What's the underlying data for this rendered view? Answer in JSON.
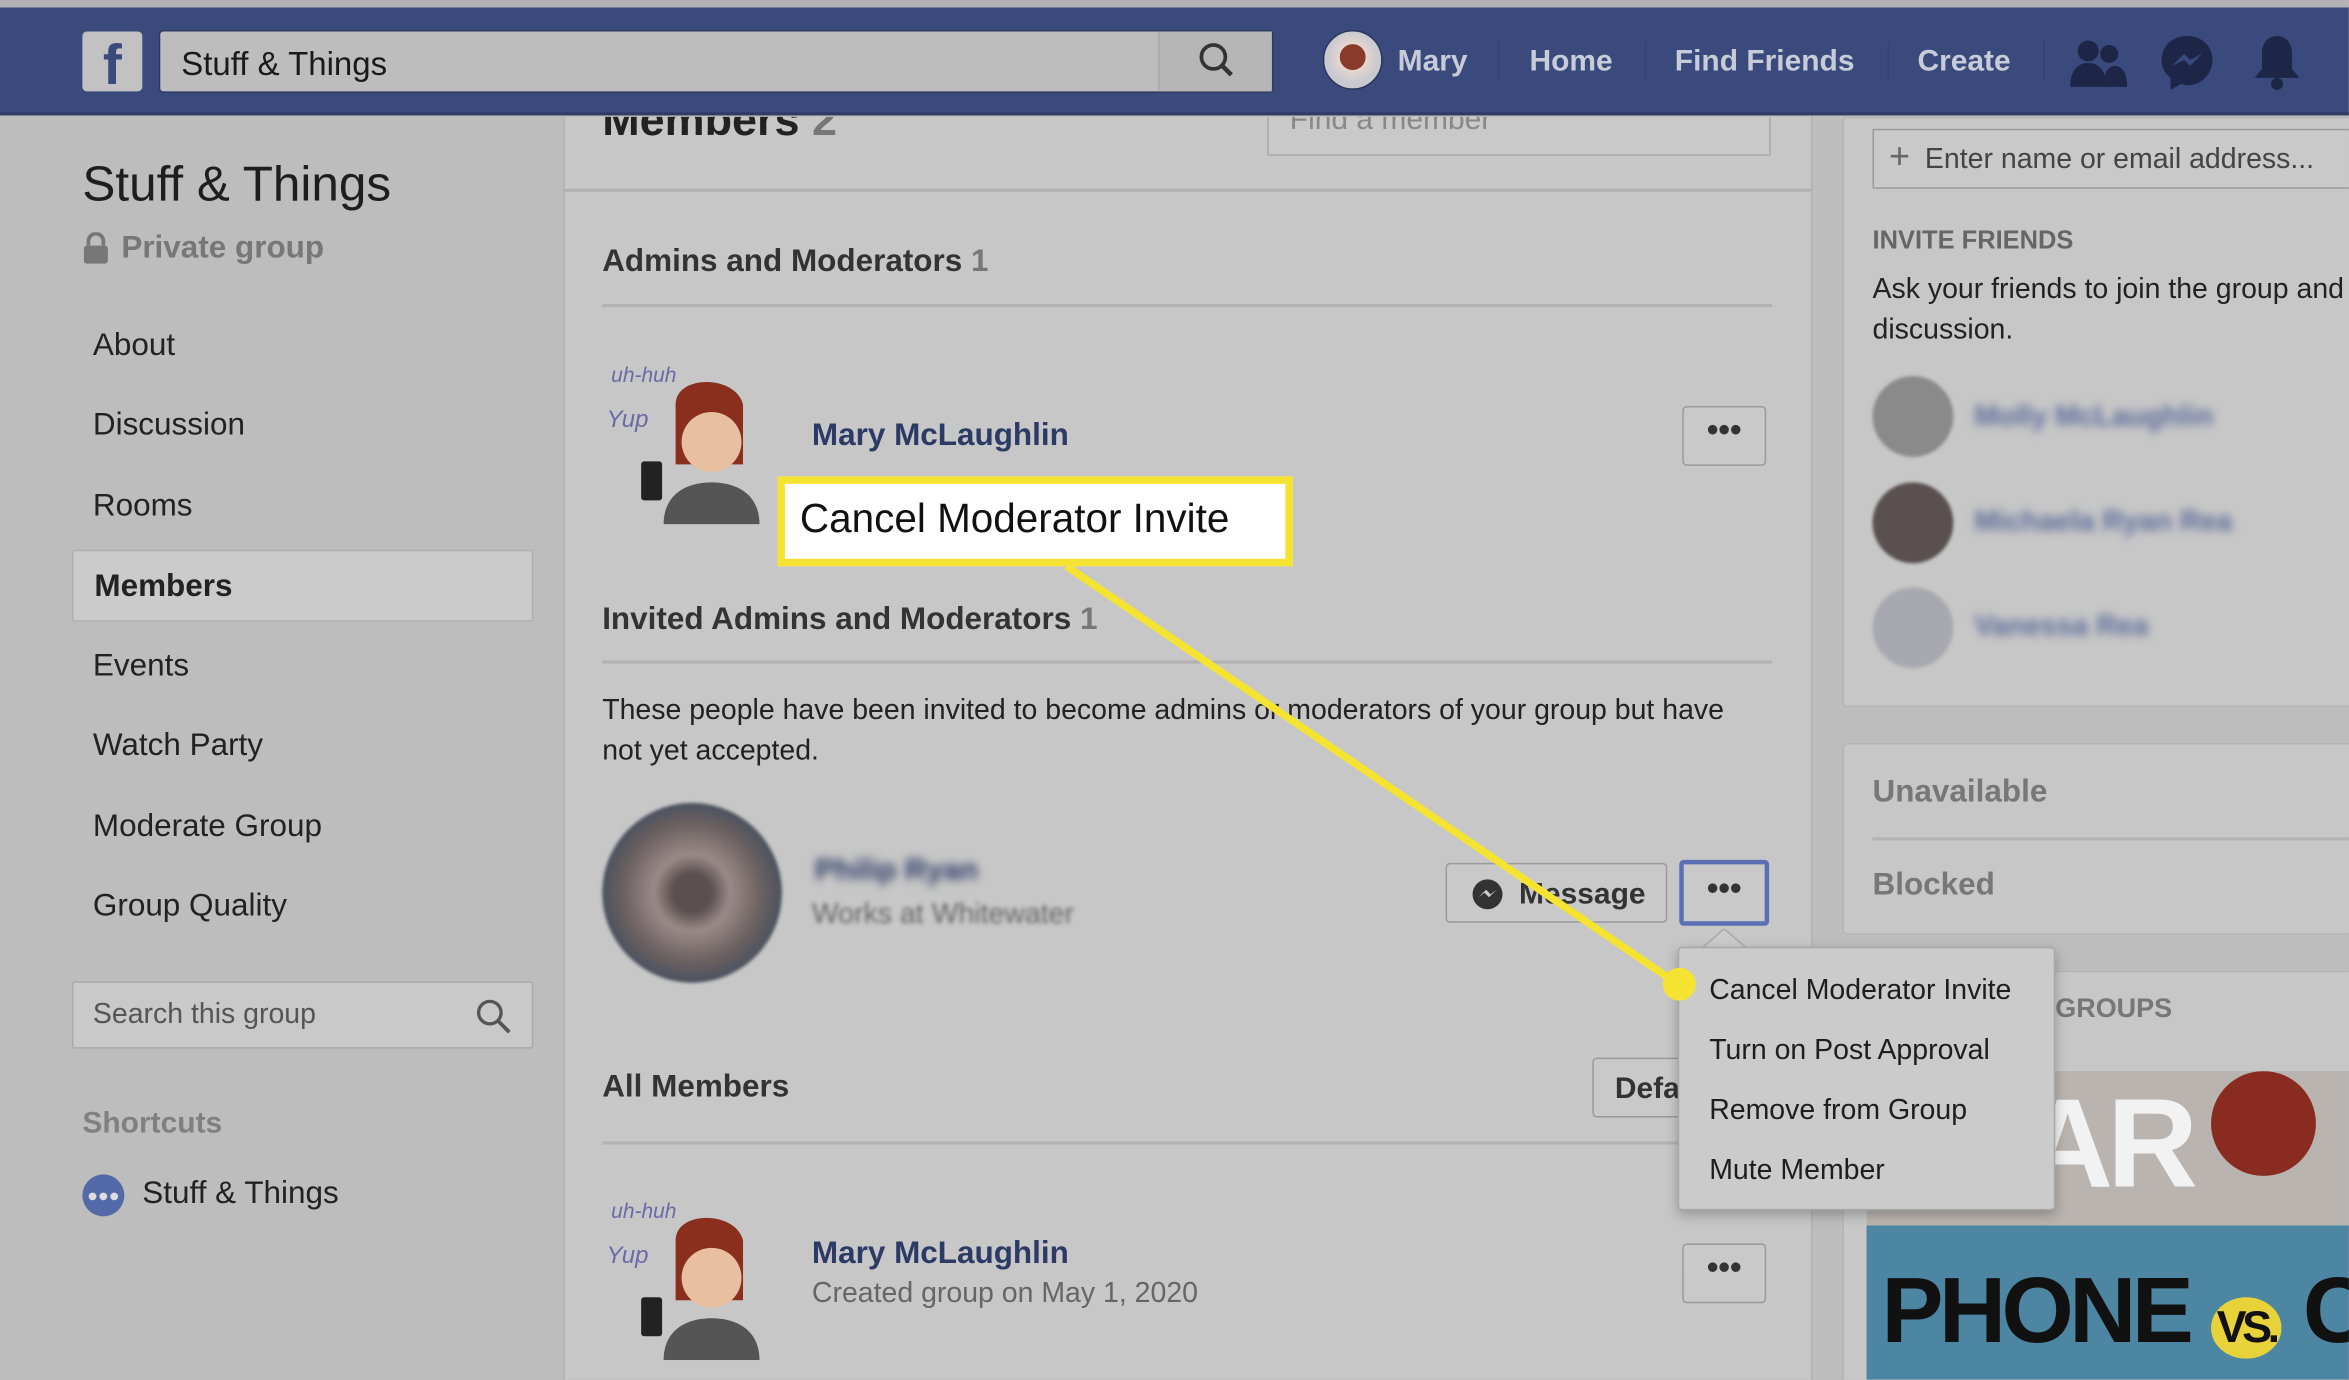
{
  "header": {
    "search_value": "Stuff & Things",
    "user": "Mary",
    "nav": [
      "Home",
      "Find Friends",
      "Create"
    ],
    "icons": [
      "facebook-logo",
      "search-icon",
      "friends-icon",
      "messenger-icon",
      "bell-icon"
    ],
    "color": "#3a4a7c"
  },
  "sidebar": {
    "group_name": "Stuff & Things",
    "privacy": "Private group",
    "items": [
      "About",
      "Discussion",
      "Rooms",
      "Members",
      "Events",
      "Watch Party",
      "Moderate Group",
      "Group Quality"
    ],
    "active": "Members",
    "search_placeholder": "Search this group",
    "shortcuts_title": "Shortcuts",
    "shortcut": "Stuff & Things"
  },
  "main": {
    "members_title": "Members",
    "members_count": "2",
    "find_placeholder": "Find a member",
    "admins_title": "Admins and Moderators",
    "admins_count": "1",
    "admin": {
      "name": "Mary McLaughlin"
    },
    "invited_title": "Invited Admins and Moderators",
    "invited_count": "1",
    "invited_desc": "These people have been invited to become admins or moderators of your group but have not yet accepted.",
    "invited_member": {
      "name": "Philip Ryan",
      "subtitle": "Works at Whitewater"
    },
    "message_label": "Message",
    "all_title": "All Members",
    "sort_label": "Default",
    "member": {
      "name": "Mary McLaughlin",
      "subtitle": "Created group on May 1, 2020"
    }
  },
  "menu": {
    "items": [
      "Cancel Moderator Invite",
      "Turn on Post Approval",
      "Remove from Group",
      "Mute Member"
    ]
  },
  "callout": {
    "text": "Cancel Moderator Invite",
    "color": "#f4e431"
  },
  "right": {
    "invite_placeholder": "Enter name or email address...",
    "invite_title": "INVITE FRIENDS",
    "invite_desc": "Ask your friends to join the group and discussion.",
    "friends": [
      "Molly McLaughlin",
      "Michaela Ryan Rea",
      "Vanessa Rea"
    ],
    "unavailable": "Unavailable",
    "blocked": "Blocked",
    "groups_title": "GROUPS"
  }
}
